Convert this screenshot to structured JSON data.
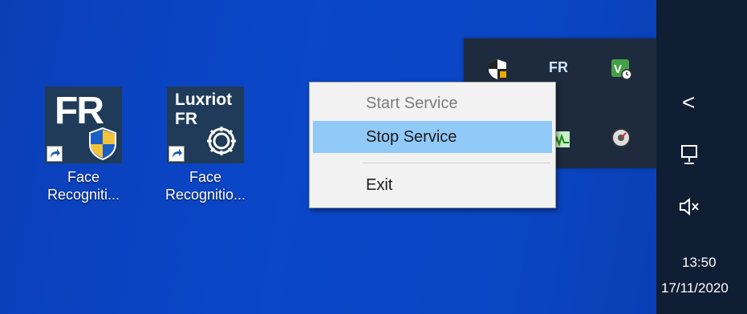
{
  "desktop": {
    "icons": [
      {
        "tile_text": "FR",
        "label_line1": "Face",
        "label_line2": "Recogniti..."
      },
      {
        "tile_line1": "Luxriot",
        "tile_line2": "FR",
        "label_line1": "Face",
        "label_line2": "Recognitio..."
      }
    ]
  },
  "tray_popup": {
    "fr_icon_text": "FR",
    "icons": [
      "shield-icon",
      "fr-icon",
      "license-app-icon",
      "monitor-graph-icon",
      "disk-clock-icon"
    ]
  },
  "context_menu": {
    "items": [
      {
        "label": "Start Service",
        "state": "disabled"
      },
      {
        "label": "Stop Service",
        "state": "highlighted"
      },
      {
        "label": "Exit",
        "state": "normal"
      }
    ]
  },
  "taskbar": {
    "chevron": "<",
    "time": "13:50",
    "date": "17/11/2020"
  },
  "colors": {
    "desktop_bg": "#0a47c9",
    "taskbar_bg": "#101e33",
    "menu_bg": "#f2f2f2",
    "menu_highlight": "#91c9f7"
  }
}
